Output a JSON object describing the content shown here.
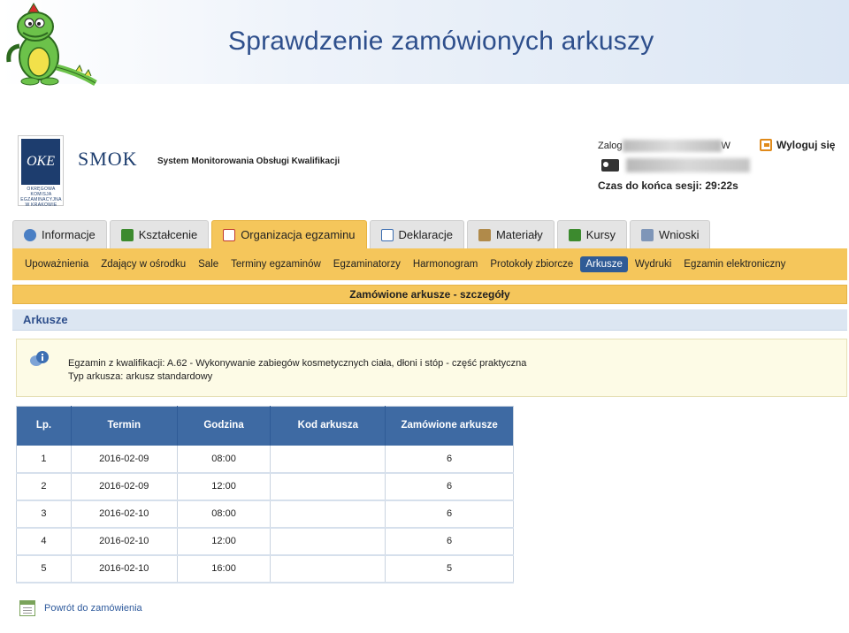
{
  "slide": {
    "title": "Sprawdzenie zamówionych arkuszy"
  },
  "header": {
    "logo_text": "OKE",
    "logo_subtext": "OKRĘGOWA KOMISJA EGZAMINACYJNA W KRAKOWIE",
    "app_name": "SMOK",
    "app_subtitle": "System Monitorowania Obsługi Kwalifikacji",
    "login_prefix": "Zalog",
    "login_suffix": "W",
    "logout_label": "Wyloguj się",
    "session_label": "Czas do końca sesji: 29:22s"
  },
  "tabs": [
    {
      "label": "Informacje",
      "icon": "info-icon",
      "active": false
    },
    {
      "label": "Kształcenie",
      "icon": "palm-icon",
      "active": false
    },
    {
      "label": "Organizacja egzaminu",
      "icon": "calendar-icon",
      "active": true
    },
    {
      "label": "Deklaracje",
      "icon": "calendar-doc-icon",
      "active": false
    },
    {
      "label": "Materiały",
      "icon": "bag-icon",
      "active": false
    },
    {
      "label": "Kursy",
      "icon": "palm-icon",
      "active": false
    },
    {
      "label": "Wnioski",
      "icon": "computer-icon",
      "active": false
    }
  ],
  "subnav": [
    {
      "label": "Upoważnienia",
      "active": false
    },
    {
      "label": "Zdający w ośrodku",
      "active": false
    },
    {
      "label": "Sale",
      "active": false
    },
    {
      "label": "Terminy egzaminów",
      "active": false
    },
    {
      "label": "Egzaminatorzy",
      "active": false
    },
    {
      "label": "Harmonogram",
      "active": false
    },
    {
      "label": "Protokoły zbiorcze",
      "active": false
    },
    {
      "label": "Arkusze",
      "active": true
    },
    {
      "label": "Wydruki",
      "active": false
    },
    {
      "label": "Egzamin elektroniczny",
      "active": false
    }
  ],
  "page": {
    "details_title": "Zamówione arkusze - szczegóły",
    "section_title": "Arkusze",
    "info_line1": "Egzamin z kwalifikacji: A.62 - Wykonywanie zabiegów kosmetycznych ciała, dłoni i stóp - część praktyczna",
    "info_line2": "Typ arkusza: arkusz standardowy",
    "back_label": "Powrót do zamówienia"
  },
  "table": {
    "headers": [
      "Lp.",
      "Termin",
      "Godzina",
      "Kod arkusza",
      "Zamówione arkusze"
    ],
    "rows": [
      [
        "1",
        "2016-02-09",
        "08:00",
        "",
        "6"
      ],
      [
        "2",
        "2016-02-09",
        "12:00",
        "",
        "6"
      ],
      [
        "3",
        "2016-02-10",
        "08:00",
        "",
        "6"
      ],
      [
        "4",
        "2016-02-10",
        "12:00",
        "",
        "6"
      ],
      [
        "5",
        "2016-02-10",
        "16:00",
        "",
        "5"
      ]
    ]
  },
  "colors": {
    "accent_yellow": "#f5c65b",
    "header_blue": "#3e6aa3",
    "title_blue": "#2e4f8c",
    "active_subnav": "#2f5b96"
  }
}
